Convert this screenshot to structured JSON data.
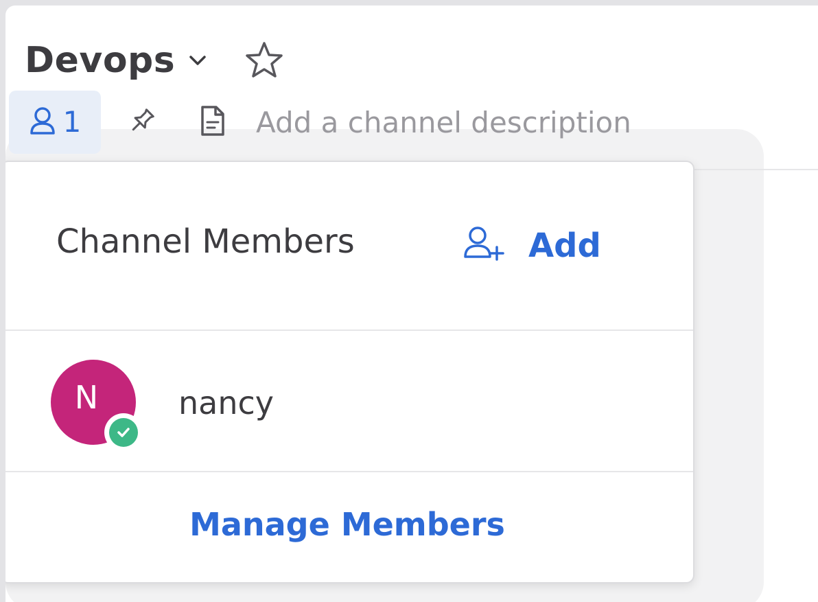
{
  "channel": {
    "name": "Devops",
    "member_count": "1",
    "description_placeholder": "Add a channel description"
  },
  "members_popover": {
    "title": "Channel Members",
    "add_label": "Add",
    "members": [
      {
        "initial": "N",
        "name": "nancy",
        "status": "online",
        "avatar_color": "#c4257a"
      }
    ],
    "manage_label": "Manage Members"
  },
  "colors": {
    "accent": "#2d6ad6",
    "status_online": "#3db887",
    "text_primary": "#3d3c40",
    "text_muted": "#9a999e"
  },
  "icons": {
    "chevron": "chevron-down-icon",
    "favorite": "star-icon",
    "members": "member-icon",
    "pin": "pin-icon",
    "files": "file-icon",
    "add_member": "add-member-icon",
    "status": "check-circle-icon"
  }
}
